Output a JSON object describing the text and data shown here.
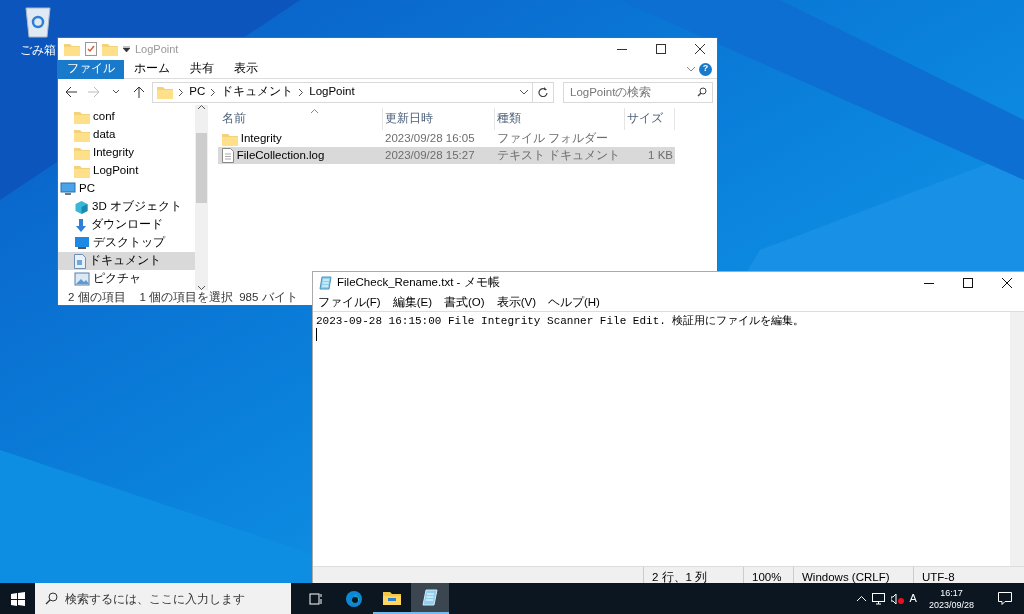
{
  "desktop_icons": [
    {
      "label": "ごみ箱"
    }
  ],
  "explorer": {
    "title": "LogPoint",
    "file_menu": "ファイル",
    "help": "?",
    "ribbon_tabs": [
      {
        "label": "ホーム",
        "selected": false
      },
      {
        "label": "共有",
        "selected": false
      },
      {
        "label": "表示",
        "selected": false
      }
    ],
    "path": [
      "PC",
      "ドキュメント",
      "LogPoint"
    ],
    "search": {
      "placeholder": "LogPointの検索"
    },
    "nav": [
      {
        "label": "conf",
        "kind": "folder",
        "selected": false
      },
      {
        "label": "data",
        "kind": "folder",
        "selected": false
      },
      {
        "label": "Integrity",
        "kind": "folder",
        "selected": false
      },
      {
        "label": "LogPoint",
        "kind": "folder",
        "selected": false
      },
      {
        "label": "PC",
        "kind": "pc",
        "selected": false,
        "children": [
          {
            "label": "3D オブジェクト",
            "kind": "cube",
            "selected": false
          },
          {
            "label": "ダウンロード",
            "kind": "download",
            "selected": false
          },
          {
            "label": "デスクトップ",
            "kind": "desktop",
            "selected": false
          },
          {
            "label": "ドキュメント",
            "kind": "documents",
            "selected": true
          },
          {
            "label": "ピクチャ",
            "kind": "pictures",
            "selected": false
          }
        ]
      }
    ],
    "columns": [
      "名前",
      "更新日時",
      "種類",
      "サイズ"
    ],
    "files": [
      {
        "name": "Integrity",
        "modified": "2023/09/28 16:05",
        "type": "ファイル フォルダー",
        "kind": "folder",
        "selected": false
      },
      {
        "name": "FileCollection.log",
        "modified": "2023/09/28 15:27",
        "type": "テキスト ドキュメント",
        "size": "1 KB",
        "kind": "file",
        "selected": true
      }
    ],
    "status": [
      "2 個の項目",
      "1 個の項目を選択",
      "985 バイト"
    ]
  },
  "notepad": {
    "title": "FileCheck_Rename.txt - メモ帳",
    "menu": [
      "ファイル(F)",
      "編集(E)",
      "書式(O)",
      "表示(V)",
      "ヘルプ(H)"
    ],
    "content": "2023-09-28 16:15:00 File Integrity Scanner File Edit. 検証用にファイルを編集。",
    "status": [
      "2 行、1 列",
      "100%",
      "Windows (CRLF)",
      "UTF-8"
    ]
  },
  "taskbar": {
    "search": {
      "placeholder": "検索するには、ここに入力します"
    },
    "apps": [
      {
        "kind": "taskview",
        "running": false,
        "active": false
      },
      {
        "kind": "edge",
        "running": false,
        "active": false
      },
      {
        "kind": "explorer",
        "running": true,
        "active": false
      },
      {
        "kind": "notepad",
        "running": true,
        "active": true
      }
    ],
    "ime": "A",
    "time": "16:17",
    "date": "2023/09/28"
  }
}
